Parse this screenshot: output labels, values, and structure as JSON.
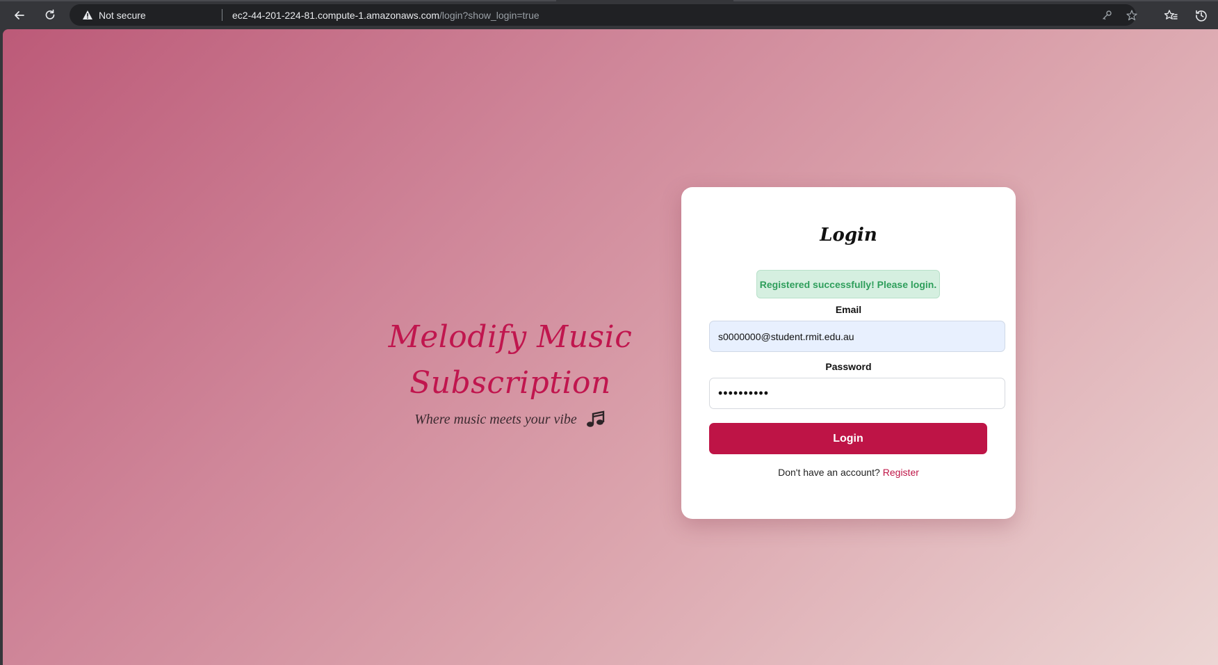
{
  "browser": {
    "security_label": "Not secure",
    "url_host": "ec2-44-201-224-81.compute-1.amazonaws.com",
    "url_path": "/login?show_login=true",
    "icons": [
      "back-icon",
      "reload-icon",
      "warning-icon",
      "key-icon",
      "star-icon",
      "favorites-icon",
      "history-icon"
    ]
  },
  "hero": {
    "title_line1": "Melodify Music",
    "title_line2": "Subscription",
    "tagline": "Where music meets your vibe",
    "tagline_icon": "music-notes-icon"
  },
  "login": {
    "title": "Login",
    "alert": "Registered successfully! Please login.",
    "email_label": "Email",
    "email_value": "s0000000@student.rmit.edu.au",
    "password_label": "Password",
    "password_value": "••••••••••",
    "submit_label": "Login",
    "footer_text": "Don't have an account?",
    "register_link": "Register"
  },
  "colors": {
    "accent": "#be1446",
    "alert_text": "#2e9e5b",
    "alert_bg": "#d5efe0",
    "gradient_start": "#bc5a78",
    "gradient_end": "#ecd6d4"
  }
}
